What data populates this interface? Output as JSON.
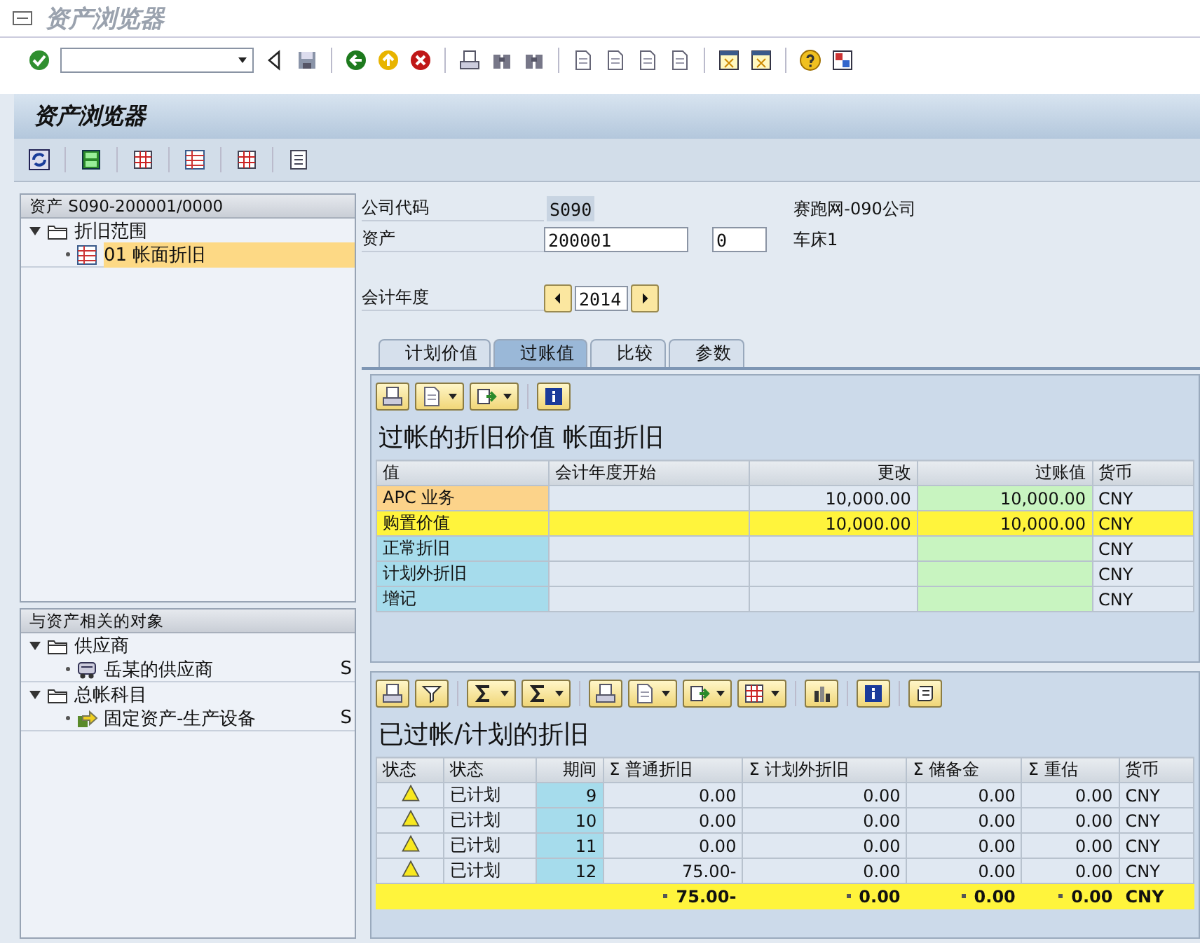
{
  "window": {
    "title": "资产浏览器"
  },
  "screen_header": {
    "title": "资产浏览器"
  },
  "asset_tree": {
    "header": "资产 S090-200001/0000",
    "items": [
      {
        "label": "折旧范围",
        "expanded": true,
        "children": [
          {
            "label": "01  帐面折旧",
            "kind": "area",
            "selected": true
          }
        ]
      }
    ]
  },
  "related_objects": {
    "header": "与资产相关的对象",
    "items": [
      {
        "label": "供应商",
        "expanded": true,
        "children": [
          {
            "label": "岳某的供应商",
            "kind": "vendor",
            "column_2": "S",
            "selected": false
          }
        ]
      },
      {
        "label": "总帐科目",
        "expanded": true,
        "children": [
          {
            "label": "固定资产-生产设备",
            "kind": "account",
            "column_2": "S",
            "selected": false
          }
        ]
      }
    ]
  },
  "fields": {
    "company_code": {
      "label": "公司代码",
      "value": "S090",
      "description": "赛跑网-090公司"
    },
    "asset": {
      "label": "资产",
      "value": "200001",
      "sub_number": "0",
      "description": "车床1"
    },
    "fiscal_year": {
      "label": "会计年度",
      "value": "2014"
    }
  },
  "tabs": [
    {
      "label": "计划价值",
      "selected": false
    },
    {
      "label": "过账值",
      "selected": true
    },
    {
      "label": "比较",
      "selected": false
    },
    {
      "label": "参数",
      "selected": false
    }
  ],
  "posted_values": {
    "title": "过帐的折旧价值 帐面折旧",
    "columns": [
      "值",
      "会计年度开始",
      "更改",
      "过账值",
      "货币"
    ],
    "rows": [
      {
        "selected": true,
        "highlighted": false,
        "cells": [
          "APC 业务",
          "",
          "10,000.00",
          "10,000.00",
          "CNY"
        ]
      },
      {
        "selected": false,
        "highlighted": true,
        "cells": [
          "购置价值",
          "",
          "10,000.00",
          "10,000.00",
          "CNY"
        ]
      },
      {
        "selected": false,
        "highlighted": false,
        "cells": [
          "正常折旧",
          "",
          "",
          "",
          "CNY"
        ]
      },
      {
        "selected": false,
        "highlighted": false,
        "cells": [
          "计划外折旧",
          "",
          "",
          "",
          "CNY"
        ]
      },
      {
        "selected": false,
        "highlighted": false,
        "cells": [
          "增记",
          "",
          "",
          "",
          "CNY"
        ]
      }
    ]
  },
  "depreciation": {
    "title": "已过帐/计划的折旧",
    "columns": [
      "状态",
      "状态",
      "期间",
      "Σ 普通折旧",
      "Σ 计划外折旧",
      "Σ 储备金",
      "Σ 重估",
      "货币"
    ],
    "rows": [
      {
        "kind": "warning",
        "status_text": "已计划",
        "period": "9",
        "values": [
          "0.00",
          "0.00",
          "0.00",
          "0.00"
        ],
        "currency": "CNY"
      },
      {
        "kind": "warning",
        "status_text": "已计划",
        "period": "10",
        "values": [
          "0.00",
          "0.00",
          "0.00",
          "0.00"
        ],
        "currency": "CNY"
      },
      {
        "kind": "warning",
        "status_text": "已计划",
        "period": "11",
        "values": [
          "0.00",
          "0.00",
          "0.00",
          "0.00"
        ],
        "currency": "CNY"
      },
      {
        "kind": "warning",
        "status_text": "已计划",
        "period": "12",
        "values": [
          "75.00-",
          "0.00",
          "0.00",
          "0.00"
        ],
        "currency": "CNY"
      }
    ],
    "totals": {
      "values": [
        "75.00-",
        "0.00",
        "0.00",
        "0.00"
      ],
      "currency": "CNY"
    }
  }
}
